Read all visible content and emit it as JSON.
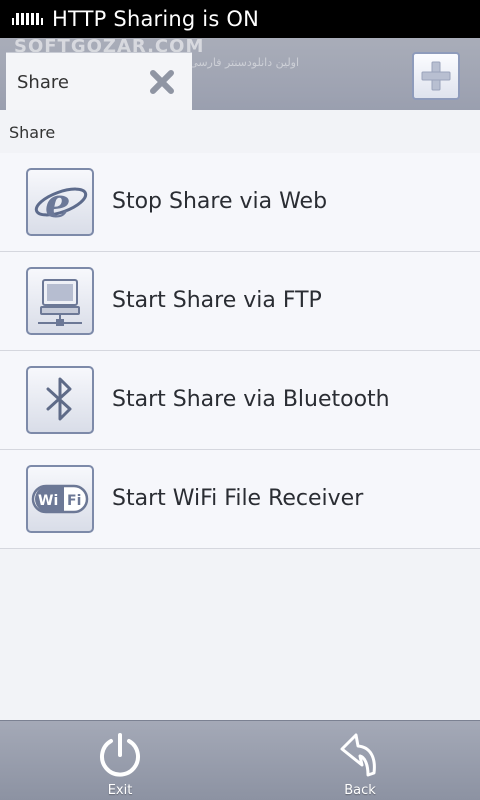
{
  "status_bar": {
    "icon": "http-sharing-icon",
    "text": "HTTP Sharing is ON"
  },
  "watermark": {
    "text": "SOFTGOZAR.COM",
    "subtext": "اولین دانلودسنتر فارسی وب"
  },
  "header": {
    "tab_label": "Share",
    "add_button_icon": "plus-icon",
    "close_icon": "close-icon"
  },
  "section": {
    "title": "Share"
  },
  "items": [
    {
      "label": "Stop Share via Web",
      "icon": "internet-explorer-icon"
    },
    {
      "label": "Start Share via FTP",
      "icon": "network-computer-icon"
    },
    {
      "label": "Start Share via Bluetooth",
      "icon": "bluetooth-icon"
    },
    {
      "label": "Start WiFi File Receiver",
      "icon": "wifi-icon"
    }
  ],
  "bottom_bar": {
    "exit_label": "Exit",
    "back_label": "Back"
  },
  "colors": {
    "status_bar": "#000000",
    "header": "#a4a9b7",
    "content_bg": "#f2f3f7",
    "icon_border": "#7d8aa9"
  }
}
